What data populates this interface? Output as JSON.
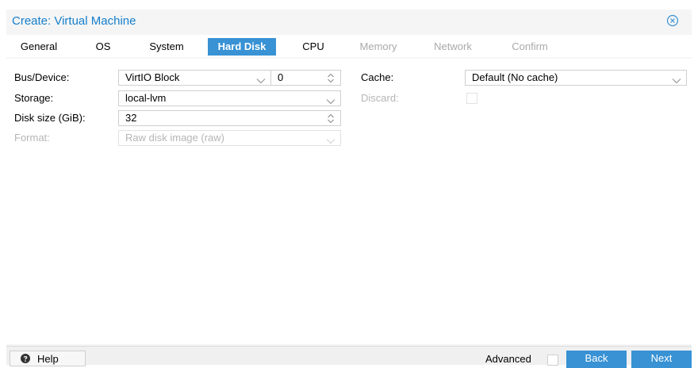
{
  "window": {
    "title": "Create: Virtual Machine"
  },
  "tabs": [
    {
      "label": "General",
      "state": "normal"
    },
    {
      "label": "OS",
      "state": "normal"
    },
    {
      "label": "System",
      "state": "normal"
    },
    {
      "label": "Hard Disk",
      "state": "active"
    },
    {
      "label": "CPU",
      "state": "normal"
    },
    {
      "label": "Memory",
      "state": "disabled"
    },
    {
      "label": "Network",
      "state": "disabled"
    },
    {
      "label": "Confirm",
      "state": "disabled"
    }
  ],
  "form": {
    "bus_device": {
      "label": "Bus/Device:",
      "bus_value": "VirtIO Block",
      "device_value": "0"
    },
    "storage": {
      "label": "Storage:",
      "value": "local-lvm"
    },
    "disk_size": {
      "label": "Disk size (GiB):",
      "value": "32"
    },
    "format": {
      "label": "Format:",
      "value": "Raw disk image (raw)",
      "disabled": true
    },
    "cache": {
      "label": "Cache:",
      "value": "Default (No cache)"
    },
    "discard": {
      "label": "Discard:",
      "checked": false,
      "disabled": true
    }
  },
  "footer": {
    "help_label": "Help",
    "advanced_label": "Advanced",
    "advanced_checked": false,
    "back_label": "Back",
    "next_label": "Next"
  },
  "colors": {
    "accent": "#3892d4",
    "title": "#157fcc",
    "disabled_text": "#b5b5b5"
  },
  "icons": [
    "close-circle-icon",
    "chevron-down-icon",
    "spinner-arrows-icon",
    "question-circle-icon"
  ]
}
